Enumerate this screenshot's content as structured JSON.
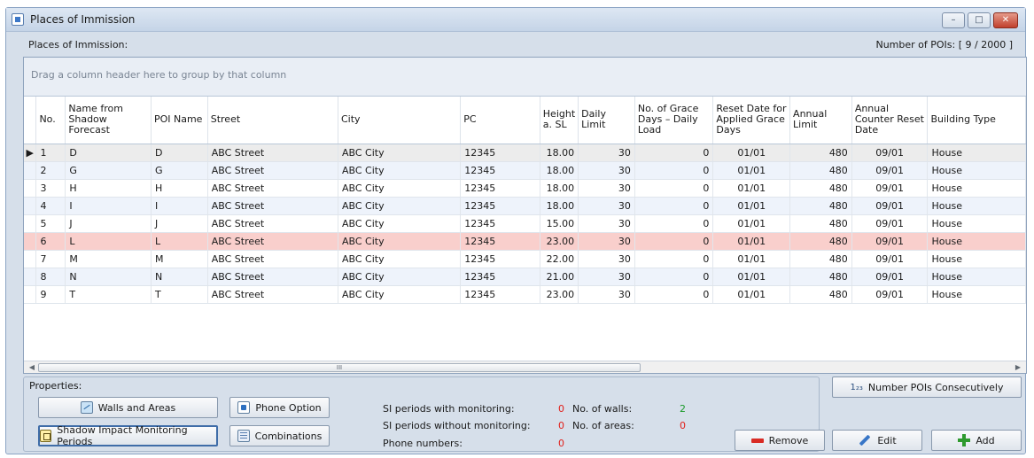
{
  "window": {
    "title": "Places of Immission",
    "controls": {
      "minimize": "–",
      "maximize": "□",
      "close": "✕"
    }
  },
  "header": {
    "left_label": "Places of Immission:",
    "poi_count": "Number of POIs: [ 9 / 2000 ]"
  },
  "grid": {
    "group_hint": "Drag a column header here to group by that column",
    "columns": [
      "No.",
      "Name from Shadow Forecast",
      "POI Name",
      "Street",
      "City",
      "PC",
      "Height a. SL",
      "Daily Limit",
      "No. of Grace Days – Daily Load",
      "Reset Date for Applied Grace Days",
      "Annual Limit",
      "Annual Counter Reset Date",
      "Building Type"
    ],
    "current_row_marker": "▶",
    "rows": [
      [
        "1",
        "D",
        "D",
        "ABC Street",
        "ABC City",
        "12345",
        "18.00",
        "30",
        "0",
        "01/01",
        "480",
        "09/01",
        "House"
      ],
      [
        "2",
        "G",
        "G",
        "ABC Street",
        "ABC City",
        "12345",
        "18.00",
        "30",
        "0",
        "01/01",
        "480",
        "09/01",
        "House"
      ],
      [
        "3",
        "H",
        "H",
        "ABC Street",
        "ABC City",
        "12345",
        "18.00",
        "30",
        "0",
        "01/01",
        "480",
        "09/01",
        "House"
      ],
      [
        "4",
        "I",
        "I",
        "ABC Street",
        "ABC City",
        "12345",
        "18.00",
        "30",
        "0",
        "01/01",
        "480",
        "09/01",
        "House"
      ],
      [
        "5",
        "J",
        "J",
        "ABC Street",
        "ABC City",
        "12345",
        "15.00",
        "30",
        "0",
        "01/01",
        "480",
        "09/01",
        "House"
      ],
      [
        "6",
        "L",
        "L",
        "ABC Street",
        "ABC City",
        "12345",
        "23.00",
        "30",
        "0",
        "01/01",
        "480",
        "09/01",
        "House"
      ],
      [
        "7",
        "M",
        "M",
        "ABC Street",
        "ABC City",
        "12345",
        "22.00",
        "30",
        "0",
        "01/01",
        "480",
        "09/01",
        "House"
      ],
      [
        "8",
        "N",
        "N",
        "ABC Street",
        "ABC City",
        "12345",
        "21.00",
        "30",
        "0",
        "01/01",
        "480",
        "09/01",
        "House"
      ],
      [
        "9",
        "T",
        "T",
        "ABC Street",
        "ABC City",
        "12345",
        "23.00",
        "30",
        "0",
        "01/01",
        "480",
        "09/01",
        "House"
      ]
    ],
    "scrollbar": {
      "left_arrow": "◀",
      "right_arrow": "▶",
      "thumb_grip": "III"
    }
  },
  "properties": {
    "label": "Properties:",
    "buttons": {
      "walls_and_areas": "Walls and Areas",
      "phone_option": "Phone Option",
      "shadow_impact": "Shadow Impact Monitoring Periods",
      "combinations": "Combinations"
    },
    "stats": {
      "si_with_label": "SI periods with monitoring:",
      "si_with_value": "0",
      "si_without_label": "SI periods without monitoring:",
      "si_without_value": "0",
      "phone_label": "Phone numbers:",
      "phone_value": "0",
      "walls_label": "No. of walls:",
      "walls_value": "2",
      "areas_label": "No. of areas:",
      "areas_value": "0"
    }
  },
  "actions": {
    "number_consecutively": "Number POIs Consecutively",
    "number_icon_text": "1₂₃",
    "remove": "Remove",
    "edit": "Edit",
    "add": "Add"
  },
  "colors": {
    "highlight_row": "#f9cfcc",
    "alt_row": "#eef3fb",
    "value_red": "#e0201b",
    "value_green": "#1a9a2a"
  }
}
